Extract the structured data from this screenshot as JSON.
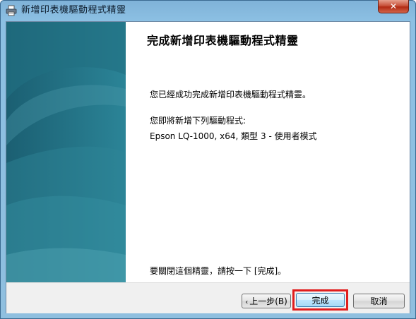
{
  "window": {
    "title": "新增印表機驅動程式精靈",
    "close_symbol": "✕"
  },
  "icons": {
    "title": "printer-icon",
    "close": "close-icon",
    "back_arrow": "chevron-left-icon"
  },
  "wizard": {
    "heading": "完成新增印表機驅動程式精靈",
    "completed_message": "您已經成功完成新增印表機驅動程式精靈。",
    "about_to_add_label": "您即將新增下列驅動程式:",
    "driver_name": "Epson LQ-1000, x64, 類型 3 - 使用者模式",
    "close_instruction": "要關閉這個精靈，請按一下 [完成]。"
  },
  "buttons": {
    "back_label": "上一步(B)",
    "finish_label": "完成",
    "cancel_label": "取消"
  },
  "colors": {
    "sidebar": "#1d6f83",
    "highlight_border": "#e11d1d"
  }
}
